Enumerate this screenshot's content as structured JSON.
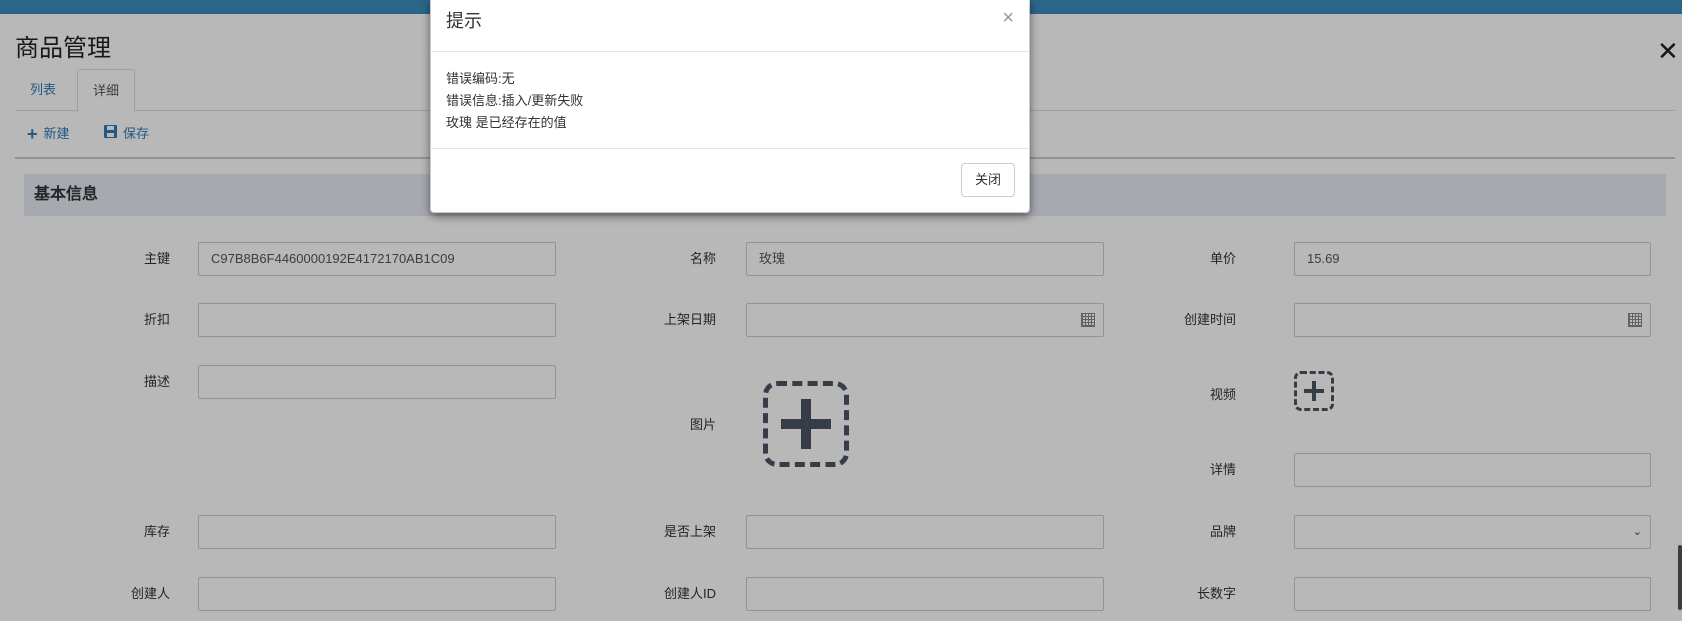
{
  "page": {
    "title": "商品管理",
    "close_symbol": "✕"
  },
  "tabs": [
    {
      "label": "列表"
    },
    {
      "label": "详细"
    }
  ],
  "toolbar": {
    "new_label": "新建",
    "save_label": "保存"
  },
  "section": {
    "title": "基本信息"
  },
  "fields": {
    "id": {
      "label": "主键",
      "value": "C97B8B6F4460000192E4172170AB1C09"
    },
    "name": {
      "label": "名称",
      "value": "玫瑰"
    },
    "price": {
      "label": "单价",
      "value": "15.69"
    },
    "discount": {
      "label": "折扣",
      "value": ""
    },
    "listing_date": {
      "label": "上架日期",
      "value": ""
    },
    "created_time": {
      "label": "创建时间",
      "value": ""
    },
    "description": {
      "label": "描述",
      "value": ""
    },
    "image": {
      "label": "图片"
    },
    "video": {
      "label": "视频"
    },
    "details": {
      "label": "详情",
      "value": ""
    },
    "stock": {
      "label": "库存",
      "value": ""
    },
    "is_listed": {
      "label": "是否上架",
      "value": ""
    },
    "brand": {
      "label": "品牌",
      "value": ""
    },
    "creator": {
      "label": "创建人",
      "value": ""
    },
    "creator_id": {
      "label": "创建人ID",
      "value": ""
    },
    "long_number": {
      "label": "长数字",
      "value": ""
    }
  },
  "modal": {
    "title": "提示",
    "close_symbol": "×",
    "lines": [
      "错误编码:无",
      "错误信息:插入/更新失败",
      "玫瑰 是已经存在的值"
    ],
    "close_button": "关闭"
  },
  "colors": {
    "topbar": "#3c8dbc",
    "link": "#337ab7",
    "section_bg": "#e6ebf4"
  }
}
